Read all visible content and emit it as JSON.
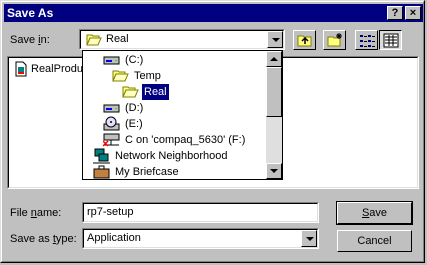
{
  "window": {
    "title": "Save As",
    "help_glyph": "?",
    "close_glyph": "×"
  },
  "save_in": {
    "label_pre": "Save ",
    "label_key": "i",
    "label_post": "n:",
    "value": "Real"
  },
  "dropdown": {
    "items": [
      {
        "label": "(C:)",
        "icon": "drive-icon"
      },
      {
        "label": "Temp",
        "icon": "folder-open-icon"
      },
      {
        "label": "Real",
        "icon": "folder-open-icon",
        "selected": true
      },
      {
        "label": "(D:)",
        "icon": "drive-icon"
      },
      {
        "label": "(E:)",
        "icon": "cd-drive-icon"
      },
      {
        "label": "C on 'compaq_5630' (F:)",
        "icon": "network-drive-icon"
      },
      {
        "label": "Network Neighborhood",
        "icon": "network-neighborhood-icon"
      },
      {
        "label": "My Briefcase",
        "icon": "briefcase-icon"
      }
    ]
  },
  "file_list": {
    "items": [
      {
        "label": "RealProdu",
        "icon": "file-icon"
      }
    ]
  },
  "file_name": {
    "label_pre": "File ",
    "label_key": "n",
    "label_post": "ame:",
    "value": "rp7-setup"
  },
  "save_as_type": {
    "label_pre": "Save as ",
    "label_key": "t",
    "label_post": "ype:",
    "value": "Application"
  },
  "buttons": {
    "save_key": "S",
    "save_rest": "ave",
    "cancel": "Cancel"
  }
}
